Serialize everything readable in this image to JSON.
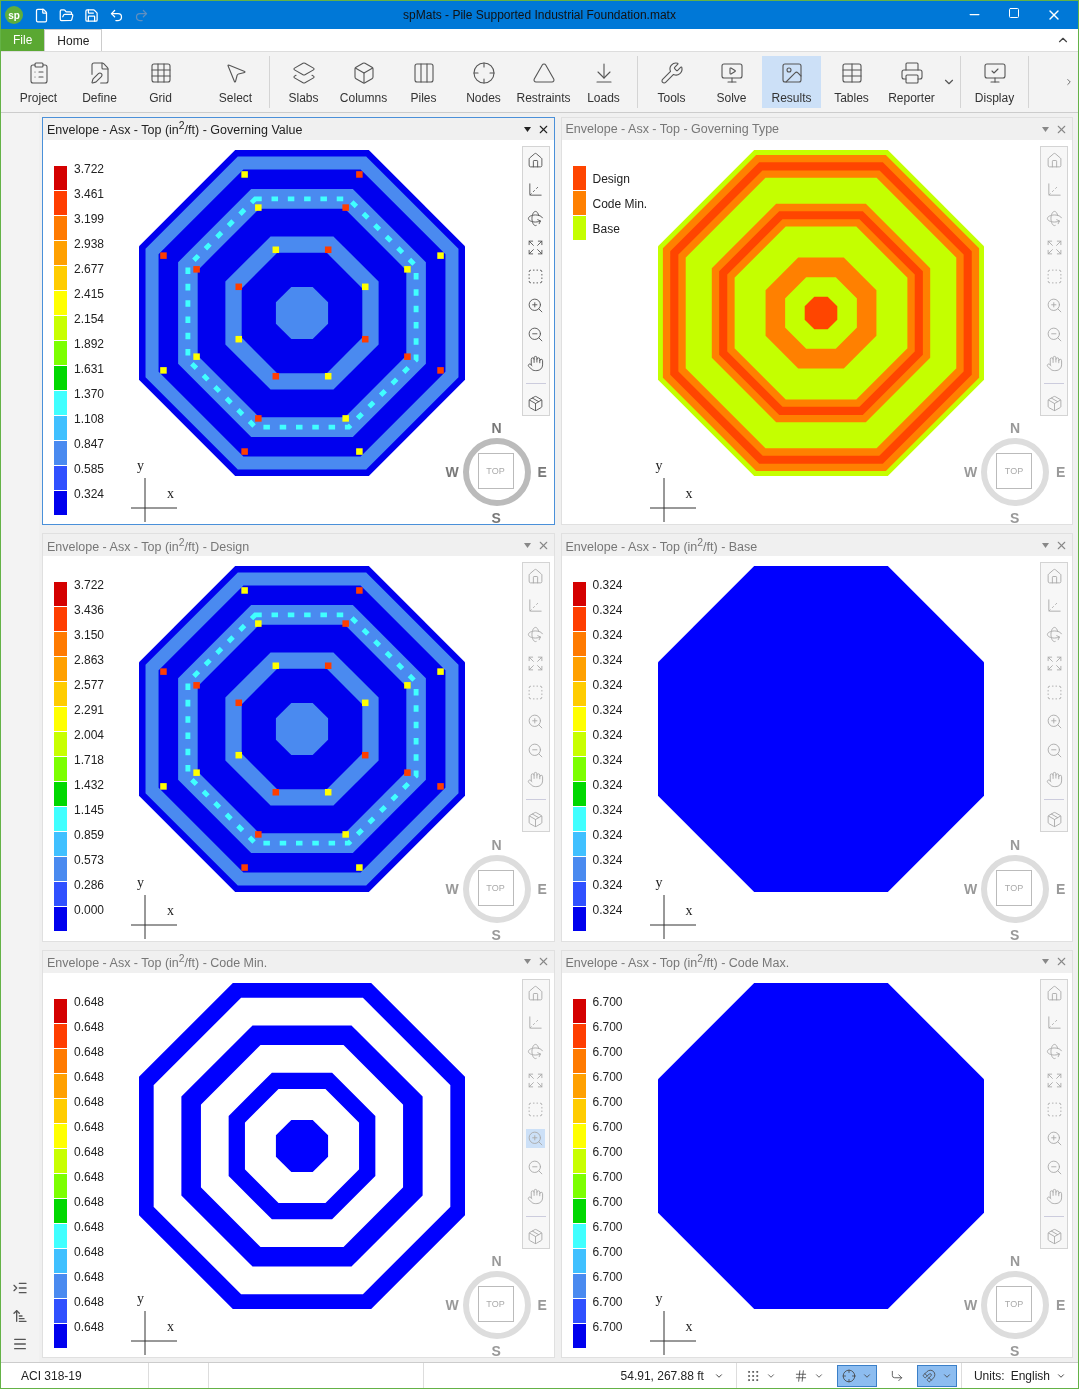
{
  "window": {
    "app_logo": "sp",
    "title": "spMats - Pile Supported Industrial Foundation.matx"
  },
  "quick_access": [
    {
      "disabled": false
    },
    {
      "disabled": false
    },
    {
      "disabled": false
    },
    {
      "disabled": false
    },
    {
      "disabled": true
    }
  ],
  "tabs": [
    {
      "label": "File",
      "selected": false
    },
    {
      "label": "Home",
      "selected": true
    }
  ],
  "ribbon_groups": [
    {
      "buttons": [
        {
          "label": "Project",
          "selected": false
        },
        {
          "label": "Define",
          "selected": false
        },
        {
          "label": "Grid",
          "selected": false
        },
        {
          "label": "Select",
          "selected": false
        }
      ]
    },
    {
      "buttons": [
        {
          "label": "Slabs",
          "selected": false
        },
        {
          "label": "Columns",
          "selected": false
        },
        {
          "label": "Piles",
          "selected": false
        },
        {
          "label": "Nodes",
          "selected": false
        },
        {
          "label": "Restraints",
          "selected": false
        },
        {
          "label": "Loads",
          "selected": false
        }
      ]
    },
    {
      "buttons": [
        {
          "label": "Tools",
          "selected": false
        },
        {
          "label": "Solve",
          "selected": false
        },
        {
          "label": "Results",
          "selected": true
        },
        {
          "label": "Tables",
          "selected": false
        },
        {
          "label": "Reporter",
          "selected": false
        }
      ]
    },
    {
      "buttons": [
        {
          "label": "Display",
          "selected": false
        }
      ]
    }
  ],
  "panels": [
    {
      "title": "Envelope - Asx - Top (in$^{2}$/ft) - Governing Value",
      "selected": true,
      "zoom_tool_on": false,
      "kind": "value-contour",
      "legend": {
        "kind": "gradient",
        "labels": [
          "3.722",
          "3.461",
          "3.199",
          "2.938",
          "2.677",
          "2.415",
          "2.154",
          "1.892",
          "1.631",
          "1.370",
          "1.108",
          "0.847",
          "0.585",
          "0.324"
        ]
      },
      "axis_labels": [
        "y",
        "x"
      ],
      "compass": [
        "N",
        "W",
        "TOP",
        "E",
        "S"
      ]
    },
    {
      "title": "Envelope - Asx - Top - Governing Type",
      "selected": false,
      "zoom_tool_on": false,
      "kind": "type-map",
      "legend": {
        "kind": "categories",
        "items": [
          {
            "label": "Design",
            "color": "#ff4500"
          },
          {
            "label": "Code Min.",
            "color": "#ff8000"
          },
          {
            "label": "Base",
            "color": "#c4ff00"
          }
        ]
      },
      "axis_labels": [
        "y",
        "x"
      ],
      "compass": [
        "N",
        "W",
        "TOP",
        "E",
        "S"
      ]
    },
    {
      "title": "Envelope - Asx - Top (in$^{2}$/ft) - Design",
      "selected": false,
      "zoom_tool_on": false,
      "kind": "value-contour",
      "legend": {
        "kind": "gradient",
        "labels": [
          "3.722",
          "3.436",
          "3.150",
          "2.863",
          "2.577",
          "2.291",
          "2.004",
          "1.718",
          "1.432",
          "1.145",
          "0.859",
          "0.573",
          "0.286",
          "0.000"
        ]
      },
      "axis_labels": [
        "y",
        "x"
      ],
      "compass": [
        "N",
        "W",
        "TOP",
        "E",
        "S"
      ]
    },
    {
      "title": "Envelope - Asx - Top (in$^{2}$/ft) - Base",
      "selected": false,
      "zoom_tool_on": false,
      "kind": "solid",
      "legend": {
        "kind": "gradient",
        "labels": [
          "0.324",
          "0.324",
          "0.324",
          "0.324",
          "0.324",
          "0.324",
          "0.324",
          "0.324",
          "0.324",
          "0.324",
          "0.324",
          "0.324",
          "0.324",
          "0.324"
        ]
      },
      "axis_labels": [
        "y",
        "x"
      ],
      "compass": [
        "N",
        "W",
        "TOP",
        "E",
        "S"
      ]
    },
    {
      "title": "Envelope - Asx - Top (in$^{2}$/ft) - Code Min.",
      "selected": false,
      "zoom_tool_on": true,
      "kind": "two-tone",
      "legend": {
        "kind": "gradient",
        "labels": [
          "0.648",
          "0.648",
          "0.648",
          "0.648",
          "0.648",
          "0.648",
          "0.648",
          "0.648",
          "0.648",
          "0.648",
          "0.648",
          "0.648",
          "0.648",
          "0.648"
        ]
      },
      "axis_labels": [
        "y",
        "x"
      ],
      "compass": [
        "N",
        "W",
        "TOP",
        "E",
        "S"
      ]
    },
    {
      "title": "Envelope - Asx - Top (in$^{2}$/ft) - Code Max.",
      "selected": false,
      "zoom_tool_on": false,
      "kind": "solid",
      "legend": {
        "kind": "gradient",
        "labels": [
          "6.700",
          "6.700",
          "6.700",
          "6.700",
          "6.700",
          "6.700",
          "6.700",
          "6.700",
          "6.700",
          "6.700",
          "6.700",
          "6.700",
          "6.700",
          "6.700"
        ]
      },
      "axis_labels": [
        "y",
        "x"
      ],
      "compass": [
        "N",
        "W",
        "TOP",
        "E",
        "S"
      ]
    }
  ],
  "status_bar": {
    "code": "ACI 318-19",
    "coordinates": "54.91, 267.88 ft",
    "toggles": [
      {
        "on": false
      },
      {
        "on": false
      },
      {
        "on": true
      },
      {
        "on": false
      },
      {
        "on": true
      }
    ],
    "units_label": "Units:",
    "units": "English"
  }
}
